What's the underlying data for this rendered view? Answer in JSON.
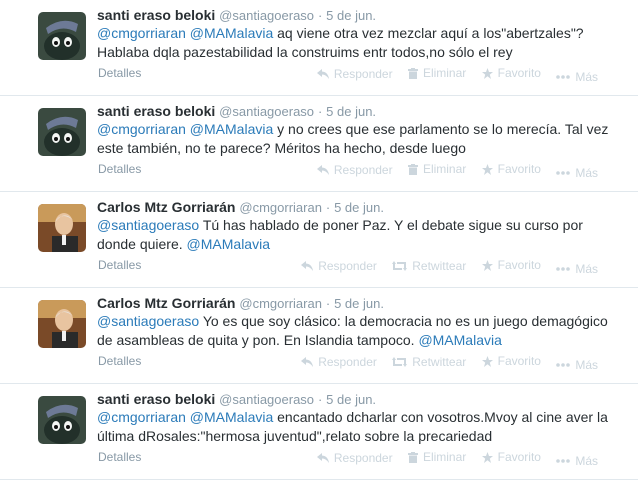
{
  "tweets": [
    {
      "author_type": "santi",
      "name": "santi eraso beloki",
      "handle": "@santiagoeraso",
      "sep": "·",
      "date": "5 de jun.",
      "mentions": [
        "@cmgorriaran",
        "@MAMalavia"
      ],
      "text_rest": "aq viene otra vez mezclar aquí a los\"abertzales\"? Hablaba dqla pazestabilidad la construims entr todos,no sólo el rey",
      "details": "Detalles",
      "actions": {
        "reply": "Responder",
        "delete": "Eliminar",
        "favorite": "Favorito",
        "more": "Más"
      }
    },
    {
      "author_type": "santi",
      "name": "santi eraso beloki",
      "handle": "@santiagoeraso",
      "sep": "·",
      "date": "5 de jun.",
      "mentions": [
        "@cmgorriaran",
        "@MAMalavia"
      ],
      "text_rest": "y no crees que ese parlamento se lo merecía. Tal vez este también, no te parece? Méritos ha hecho, desde luego",
      "details": "Detalles",
      "actions": {
        "reply": "Responder",
        "delete": "Eliminar",
        "favorite": "Favorito",
        "more": "Más"
      }
    },
    {
      "author_type": "carlos",
      "name": "Carlos Mtz Gorriarán",
      "handle": "@cmgorriaran",
      "sep": "·",
      "date": "5 de jun.",
      "mention_lead": "@santiagoeraso",
      "text_rest": "Tú has hablado de poner Paz. Y el debate sigue su curso por donde quiere.",
      "mention_tail": "@MAMalavia",
      "details": "Detalles",
      "actions": {
        "reply": "Responder",
        "retweet": "Retwittear",
        "favorite": "Favorito",
        "more": "Más"
      }
    },
    {
      "author_type": "carlos",
      "name": "Carlos Mtz Gorriarán",
      "handle": "@cmgorriaran",
      "sep": "·",
      "date": "5 de jun.",
      "mention_lead": "@santiagoeraso",
      "text_rest": "Yo es que soy clásico: la democracia no es un juego demagógico de asambleas de quita y pon. En Islandia tampoco.",
      "mention_tail": "@MAMalavia",
      "details": "Detalles",
      "actions": {
        "reply": "Responder",
        "retweet": "Retwittear",
        "favorite": "Favorito",
        "more": "Más"
      }
    },
    {
      "author_type": "santi",
      "name": "santi eraso beloki",
      "handle": "@santiagoeraso",
      "sep": "·",
      "date": "5 de jun.",
      "mentions": [
        "@cmgorriaran",
        "@MAMalavia"
      ],
      "text_rest": "encantado dcharlar con vosotros.Mvoy al cine aver la última dRosales:\"hermosa juventud\",relato sobre la precariedad",
      "details": "Detalles",
      "actions": {
        "reply": "Responder",
        "delete": "Eliminar",
        "favorite": "Favorito",
        "more": "Más"
      }
    }
  ],
  "colors": {
    "link": "#2b7bb9",
    "muted": "#8899a6",
    "action": "#ccd6dd",
    "divider": "#e1e8ed"
  },
  "icons": {
    "reply": "reply-icon",
    "delete": "trash-icon",
    "retweet": "retweet-icon",
    "favorite": "star-icon",
    "more": "more-dots-icon"
  }
}
